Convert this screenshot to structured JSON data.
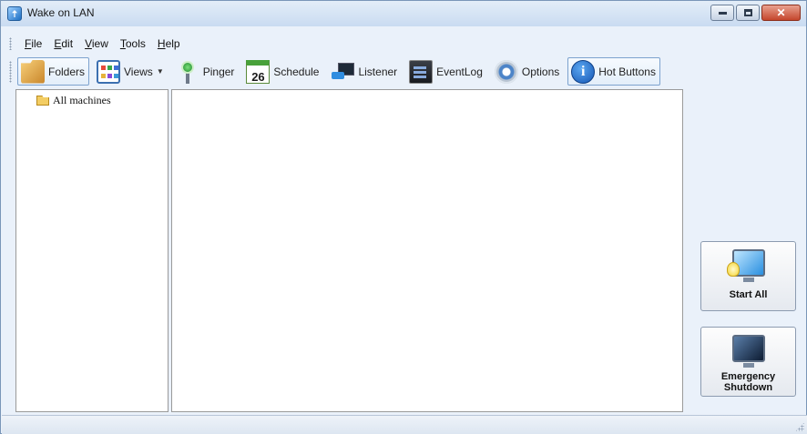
{
  "window": {
    "title": "Wake on LAN",
    "buttons": {
      "minimize": "minimize",
      "maximize": "maximize",
      "close": "close"
    }
  },
  "menu": {
    "items": [
      {
        "label": "File",
        "mnemonic": "F"
      },
      {
        "label": "Edit",
        "mnemonic": "E"
      },
      {
        "label": "View",
        "mnemonic": "V"
      },
      {
        "label": "Tools",
        "mnemonic": "T"
      },
      {
        "label": "Help",
        "mnemonic": "H"
      }
    ]
  },
  "toolbar": {
    "folders": {
      "label": "Folders",
      "icon": "folders-icon",
      "checked": true
    },
    "views": {
      "label": "Views",
      "icon": "views-icon",
      "has_dropdown": true
    },
    "pinger": {
      "label": "Pinger",
      "icon": "antenna-icon"
    },
    "schedule": {
      "label": "Schedule",
      "icon": "calendar-icon",
      "calendar_day": "26"
    },
    "listener": {
      "label": "Listener",
      "icon": "network-monitor-icon"
    },
    "eventlog": {
      "label": "EventLog",
      "icon": "event-log-icon"
    },
    "options": {
      "label": "Options",
      "icon": "gear-icon"
    },
    "hot_buttons": {
      "label": "Hot Buttons",
      "icon": "info-icon",
      "checked": true
    }
  },
  "tree": {
    "items": [
      {
        "label": "All machines",
        "icon": "folder-icon"
      }
    ]
  },
  "hot_buttons": {
    "start_all": {
      "label": "Start All",
      "icon": "monitor-bulb-icon"
    },
    "emergency_shutdown": {
      "label": "Emergency\nShutdown",
      "icon": "monitor-off-icon"
    }
  },
  "colors": {
    "titlebar": "#cfe0f3",
    "close_button": "#c5462c",
    "toolbar_checked_border": "#7da2ce"
  }
}
